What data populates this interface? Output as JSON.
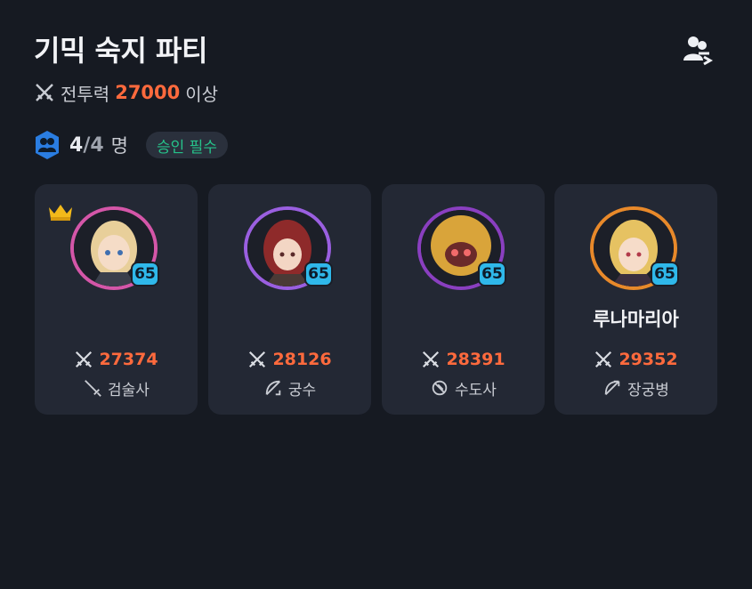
{
  "party": {
    "title": "기믹 숙지 파티",
    "power_requirement": {
      "value": "27000",
      "suffix": "이상",
      "prefix": "전투력"
    },
    "members": {
      "current": "4",
      "separator": "/",
      "max": "4",
      "unit": "명"
    },
    "approval_badge": "승인 필수"
  },
  "colors": {
    "accent_orange": "#ff6a3d",
    "badge_green": "#26c28a",
    "level_blue": "#2fb8ea"
  },
  "members": [
    {
      "name": "",
      "level": "65",
      "power": "27374",
      "class": "검술사",
      "class_icon": "sword-icon",
      "ring_color": "#d456a8",
      "leader": true
    },
    {
      "name": "",
      "level": "65",
      "power": "28126",
      "class": "궁수",
      "class_icon": "bow-icon",
      "ring_color": "#9a5fe0",
      "leader": false
    },
    {
      "name": "",
      "level": "65",
      "power": "28391",
      "class": "수도사",
      "class_icon": "monk-icon",
      "ring_color": "#8a3fc0",
      "leader": false
    },
    {
      "name": "루나마리아",
      "level": "65",
      "power": "29352",
      "class": "장궁병",
      "class_icon": "longbow-icon",
      "ring_color": "#e8892a",
      "leader": false
    }
  ]
}
